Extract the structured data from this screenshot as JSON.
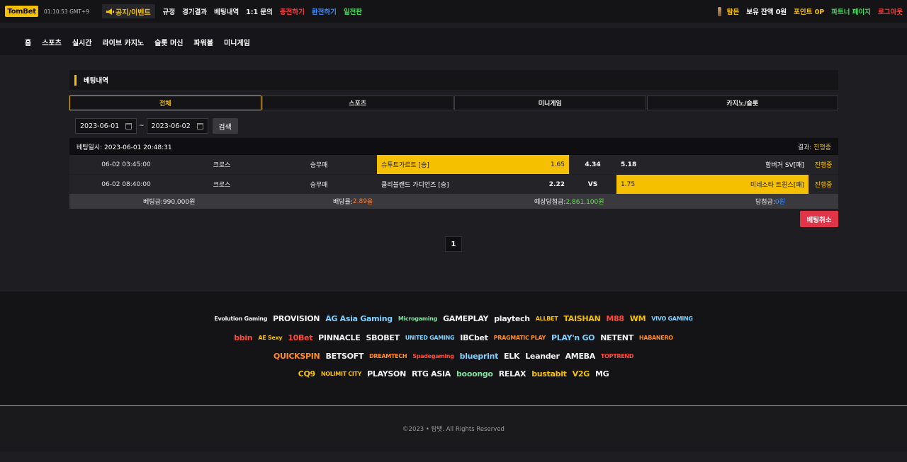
{
  "header": {
    "logo": "TomBet",
    "clock": "01:10:53 GMT+9",
    "notice_label": "공지/이벤트",
    "nav": [
      "규정",
      "경기결과",
      "베팅내역",
      "1:1 문의"
    ],
    "deposit": "충전하기",
    "withdraw": "환전하기",
    "attendance": "일전판",
    "user": "탐몬",
    "balance": "보유 잔액 0원",
    "points": "포인트 0P",
    "partner": "파트너 페이지",
    "logout": "로그아웃"
  },
  "main_nav": [
    "홈",
    "스포츠",
    "실시간",
    "라이브 카지노",
    "슬롯 머신",
    "파워볼",
    "미니게임"
  ],
  "panel": {
    "title": "베팅내역",
    "tabs": [
      "전체",
      "스포츠",
      "미니게임",
      "카지노/슬롯"
    ],
    "active_tab": "전체"
  },
  "filter": {
    "date_from": "2023-06-01",
    "date_to": "2023-06-02",
    "tilde": "~",
    "search_label": "검색"
  },
  "bet": {
    "datetime": "베팅일시: 2023-06-01 20:48:31",
    "result_label": "결과: ",
    "result_value": "진행중",
    "rows": [
      {
        "time": "06-02 03:45:00",
        "type": "크로스",
        "market": "승무패",
        "home": "슈투트가르트 [승]",
        "home_odds": "1.65",
        "mid": "4.34",
        "away_odds": "5.18",
        "away": "함버거 SV[패]",
        "status": "진행중"
      },
      {
        "time": "06-02 08:40:00",
        "type": "크로스",
        "market": "승무패",
        "home": "클리블랜드 가디언즈 [승]",
        "home_odds": "2.22",
        "mid": "VS",
        "away_odds": "1.75",
        "away": "미네소타 트윈스[패]",
        "status": "진행중"
      }
    ],
    "summary": {
      "stake_label": "베팅금: ",
      "stake": "990,000원",
      "odds_label": "배당률: ",
      "odds": "2.89",
      "odds_suffix": "율",
      "expected_label": "예상당첨금: ",
      "expected": "2,861,100원",
      "win_label": "당첨금: ",
      "win": "0원"
    },
    "cancel_label": "베팅취소"
  },
  "pagination": {
    "current": "1"
  },
  "providers": [
    [
      "Evolution Gaming",
      "PROVISION",
      "AG Asia Gaming",
      "Microgaming",
      "GAMEPLAY",
      "playtech",
      "ALLBET",
      "TAISHAN",
      "M88",
      "WM",
      "VIVO GAMING"
    ],
    [
      "bbin",
      "AE Sexy",
      "10Bet",
      "PINNACLE",
      "SBOBET",
      "UNITED GAMING",
      "IBCbet",
      "PRAGMATIC PLAY",
      "PLAY'n GO",
      "NETENT",
      "HABANERO"
    ],
    [
      "QUICKSPIN",
      "BETSOFT",
      "DREAMTECH",
      "Spadegaming",
      "blueprint",
      "ELK",
      "Leander",
      "AMEBA",
      "TOPTREND"
    ],
    [
      "CQ9",
      "NOLIMIT CITY",
      "PLAYSON",
      "RTG ASIA",
      "booongo",
      "RELAX",
      "bustabit",
      "V2G",
      "MG"
    ]
  ],
  "footer": {
    "copyright": "©2023 • 탐뱃. All Rights Reserved"
  },
  "colors": {
    "accent": "#f5c000",
    "danger": "#e03448",
    "positive": "#6ee05c",
    "info": "#3c8cff",
    "odds": "#ff7a30"
  }
}
